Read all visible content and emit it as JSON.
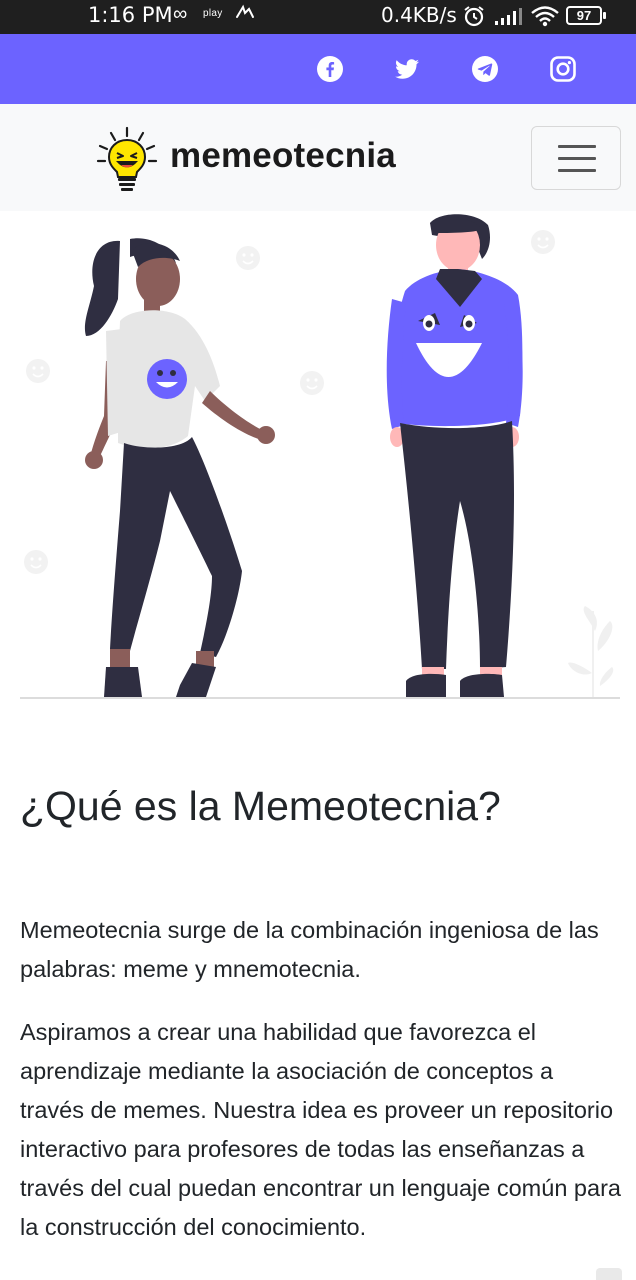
{
  "status_bar": {
    "time": "1:16 PM",
    "loop_icon": "∞",
    "play_label": "play",
    "network_speed": "0.4KB/s",
    "battery_level": "97"
  },
  "social_links": [
    {
      "icon": "facebook-icon"
    },
    {
      "icon": "twitter-icon"
    },
    {
      "icon": "telegram-icon"
    },
    {
      "icon": "instagram-icon"
    }
  ],
  "navbar": {
    "brand": "memeotecnia",
    "logo_icon": "lightbulb-meme-icon",
    "menu_icon": "hamburger-menu-icon"
  },
  "colors": {
    "accent": "#6c63ff",
    "navbar_bg": "#f8f9fa",
    "text": "#212529",
    "figure_dark": "#2f2e41",
    "logo_yellow": "#ffe600"
  },
  "hero": {
    "illustration": "two-people-meme-illustration"
  },
  "main": {
    "heading": "¿Qué es la Memeotecnia?",
    "paragraph_1": "Memeotecnia surge de la combinación ingeniosa de las palabras: meme y mnemotecnia.",
    "paragraph_2": "Aspiramos a crear una habilidad que favorezca el aprendizaje mediante la asociación de conceptos a través de memes. Nuestra idea es proveer un repositorio interactivo para profesores de todas las enseñanzas a través del cual puedan encontrar un lenguaje común para la construcción del conocimiento."
  }
}
